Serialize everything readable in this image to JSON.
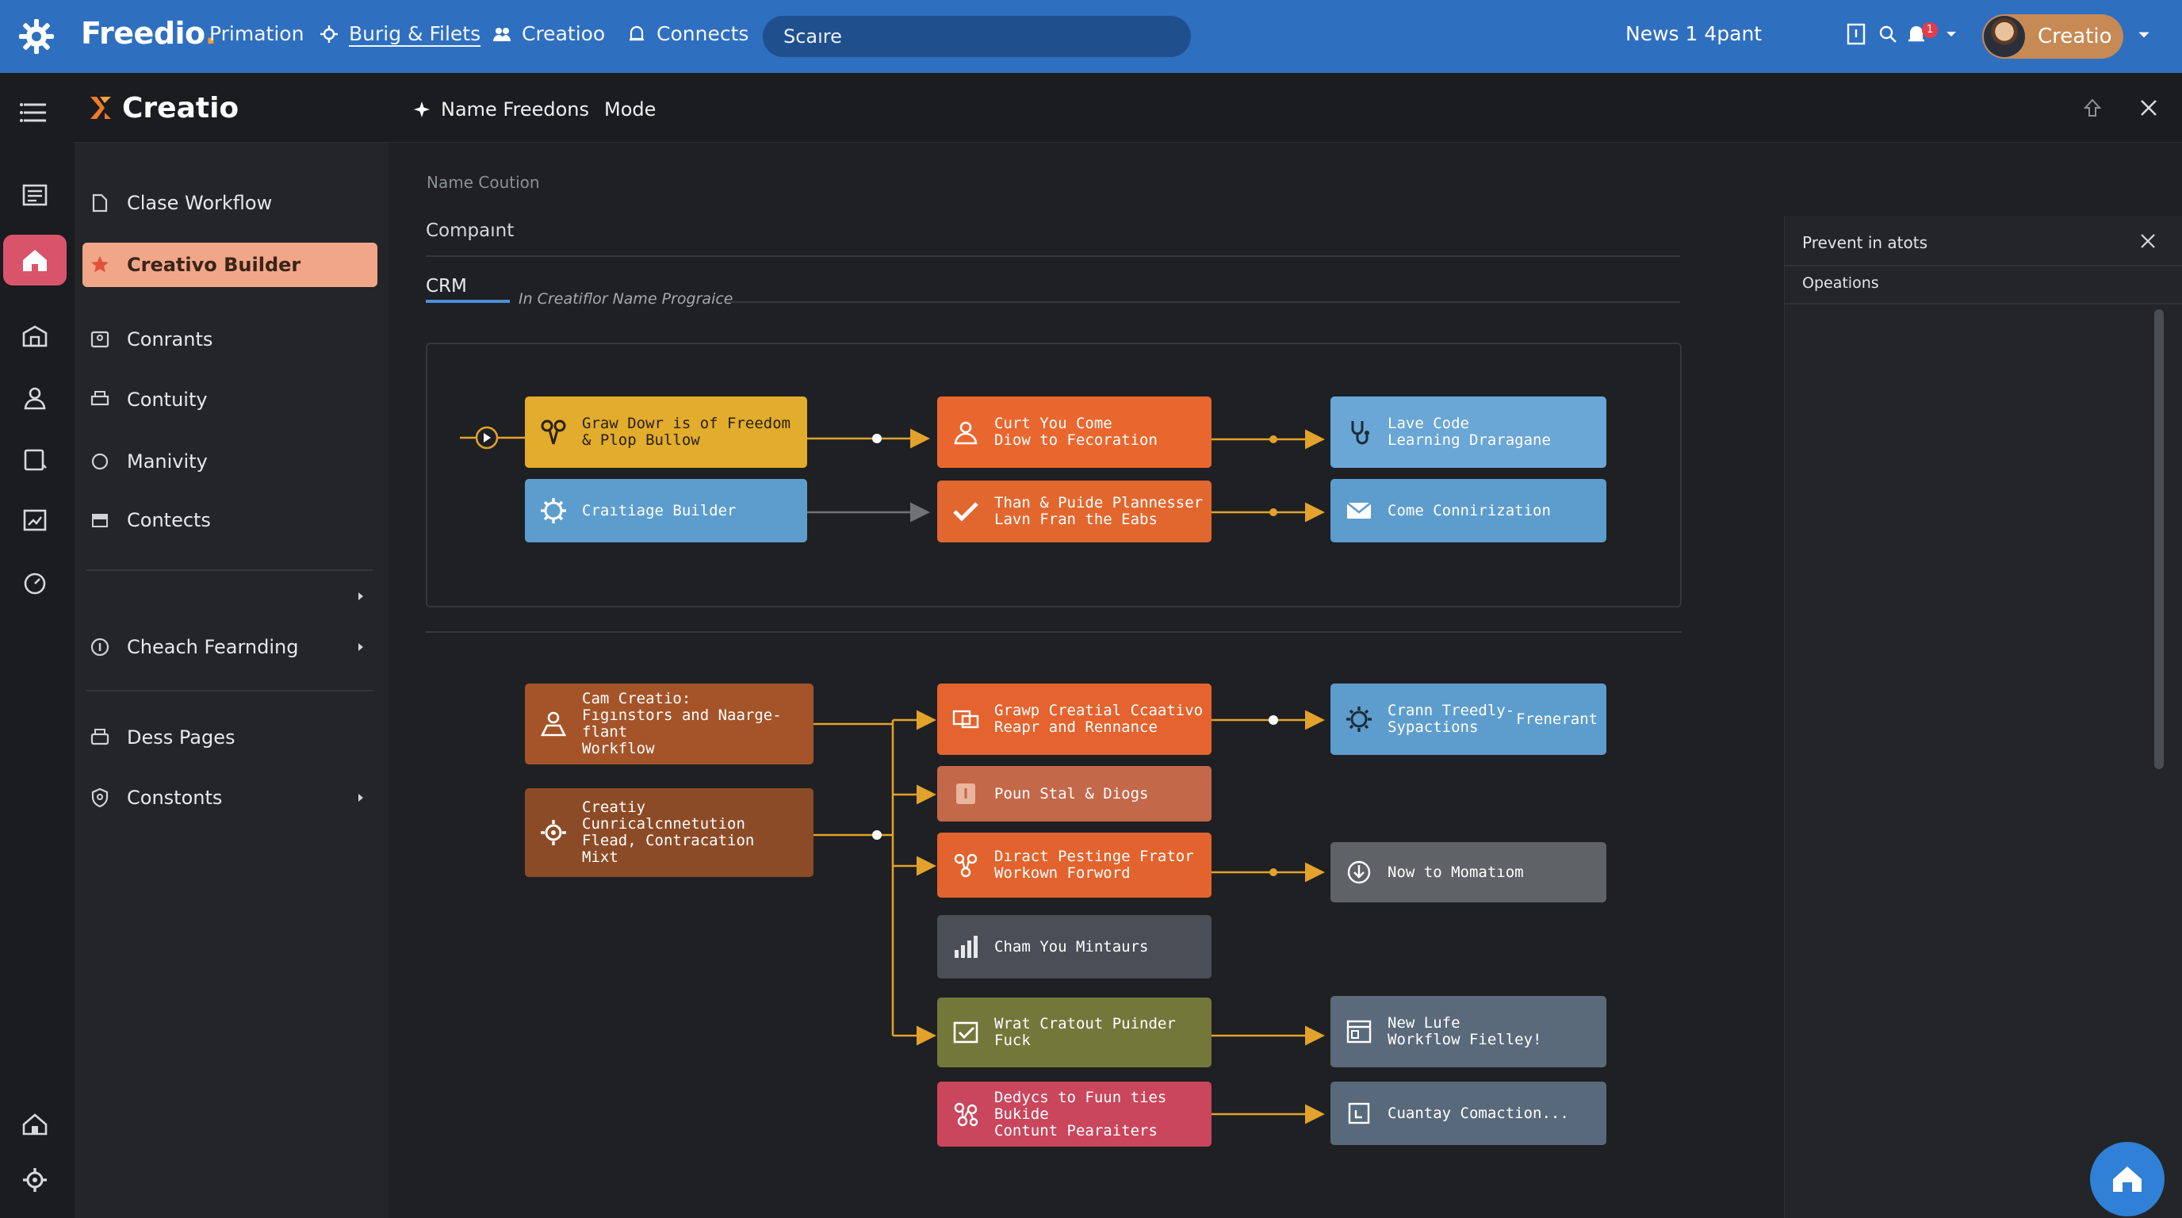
{
  "topbar": {
    "brand": "Freedio",
    "brand_dot": ".",
    "nav": [
      "Primation",
      "Burig & Filets",
      "Creatioo",
      "Connects"
    ],
    "search_placeholder": "Scaıre",
    "news": "News 1 4pant",
    "notifications_count": "1",
    "user_name": "Creatio"
  },
  "subheader": {
    "app_name": "Creatio",
    "tab_primary": "Name Freedons",
    "tab_secondary": "Mode"
  },
  "sidebar": {
    "items": [
      {
        "label": "Clase Workflow",
        "icon": "document-icon"
      },
      {
        "label": "Creativo Builder",
        "icon": "star-icon",
        "active": true
      },
      {
        "label": "Conrants",
        "icon": "contacts-icon"
      },
      {
        "label": "Contuity",
        "icon": "printer-icon"
      },
      {
        "label": "Manivity",
        "icon": "circle-icon"
      },
      {
        "label": "Contects",
        "icon": "box-icon"
      },
      {
        "label": "",
        "icon": "",
        "caret": true
      },
      {
        "label": "Cheach Fearnding",
        "icon": "info-circle-icon",
        "caret": true
      },
      {
        "label": "Dess Pages",
        "icon": "printer-icon"
      },
      {
        "label": "Constonts",
        "icon": "shield-icon",
        "caret": true
      }
    ]
  },
  "main": {
    "faint_heading": "Name Coution",
    "section_label": "Compaınt",
    "tab_label": "CRM",
    "tab_subtitle": "In Creatiflor Name Prograice"
  },
  "workflow": {
    "top": [
      {
        "id": "t1",
        "text": "Graw Dowr is of Freedom\n& Plop Bullow",
        "color": "#e2ac2c",
        "icon": "scissors-icon"
      },
      {
        "id": "t2",
        "text": "Craıtiage Builder",
        "color": "#5d9dcd",
        "icon": "gear-icon"
      },
      {
        "id": "t3",
        "text": "Curt You Come\nDiow to Fecoration",
        "color": "#e9672f",
        "icon": "user-icon"
      },
      {
        "id": "t4",
        "text": "Than & Puide Plannesser\nLavn Fran the Eabs",
        "color": "#e2672f",
        "icon": "check-icon"
      },
      {
        "id": "t5",
        "text": "Lave Code\nLearning Draragane",
        "color": "#6aa6d6",
        "icon": "stethoscope-icon"
      },
      {
        "id": "t6",
        "text": "Come Connirization",
        "color": "#5d9dcd",
        "icon": "card-icon"
      }
    ],
    "bottom": [
      {
        "id": "b1",
        "text": "Cam Creatio:\nFıgınstors and Naarge-flant\nWorkflow",
        "color": "#a5542a",
        "icon": "person-icon"
      },
      {
        "id": "b2",
        "text": "Creatiy Cunricalcnnetution\nFlead, Contracation\nMixt",
        "color": "#8c4b27",
        "icon": "gear-icon"
      },
      {
        "id": "b3",
        "text": "Grawp Creatial Ccaativo\nReapr and Rennance",
        "color": "#e4632f",
        "icon": "chat-icon"
      },
      {
        "id": "b4",
        "text": "Poun Stal & Diogs",
        "color": "#c4684a",
        "icon": "doc-icon"
      },
      {
        "id": "b5",
        "text": "Dıract Pestinge Frator\nWorkown Forword",
        "color": "#e2632d",
        "icon": "network-icon"
      },
      {
        "id": "b6",
        "text": "Cham You Mintaurs",
        "color": "#4a4f57",
        "icon": "chart-icon"
      },
      {
        "id": "b7",
        "text": "Wrat Cratout Puinder\nFuck",
        "color": "#74773a",
        "icon": "checkbox-icon"
      },
      {
        "id": "b8",
        "text": "Dedycs to Fuun ties Bukide\nContunt Pearaiters",
        "color": "#c9465c",
        "icon": "network-icon"
      },
      {
        "id": "b9",
        "text": "Crann Treedly-\nSypactions",
        "color": "#5d9dcd",
        "icon": "gear-icon",
        "suffix": "Frenerant"
      },
      {
        "id": "b10",
        "text": "Now to Momatıom",
        "color": "#5f6266",
        "icon": "download-icon"
      },
      {
        "id": "b11",
        "text": "New Lufe\nWorkflow Fielley!",
        "color": "#5b6a7b",
        "icon": "page-icon"
      },
      {
        "id": "b12",
        "text": "Cuantay Comaction...",
        "color": "#58697b",
        "icon": "square-icon"
      }
    ]
  },
  "right_panel": {
    "title": "Prevent in atots",
    "subtitle": "Opeations"
  },
  "colors": {
    "topbar": "#2f6fc0",
    "accent_active": "#f1a688",
    "wire": "#e2a22c",
    "fab": "#2f80d6"
  }
}
